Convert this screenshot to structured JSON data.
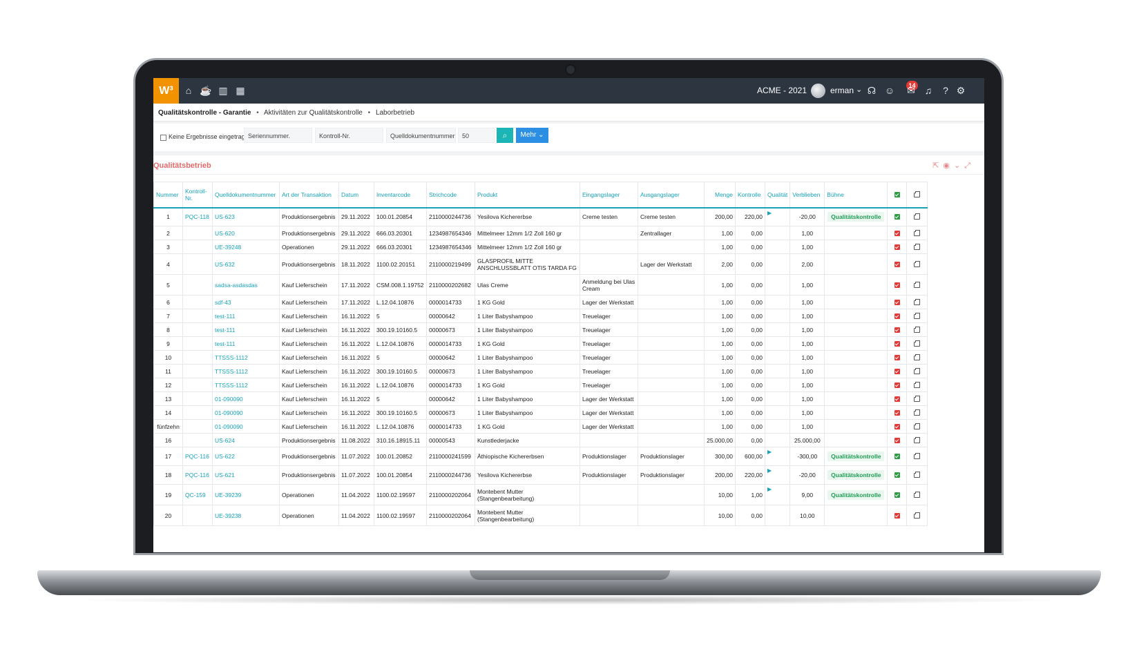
{
  "app": {
    "logo": "W³",
    "company": "ACME - 2021",
    "user": "erman",
    "notification_count": "14"
  },
  "icons": {
    "nav": [
      "home-icon",
      "cup-icon",
      "chart-icon",
      "calendar-icon"
    ],
    "right": [
      "headset-icon",
      "emoji-icon",
      "chat-icon",
      "bell-icon",
      "help-icon",
      "gear-icon"
    ]
  },
  "breadcrumb": {
    "current": "Qualitätskontrolle - Garantie",
    "items": [
      "Aktivitäten zur Qualitätskontrolle",
      "Laborbetrieb"
    ]
  },
  "filters": {
    "no_results_label": "Keine Ergebnisse eingetragen",
    "serial_placeholder": "Seriennummer.",
    "control_placeholder": "Kontroll-Nr.",
    "source_placeholder": "Quelldokumentnummer",
    "limit_value": "50",
    "more_label": "Mehr"
  },
  "panel": {
    "title": "Qualitätsbetrieb"
  },
  "table": {
    "headers": {
      "num": "Nummer",
      "ctrl": "Kontroll-Nr.",
      "src": "Quelldokumentnummer",
      "type": "Art der Transaktion",
      "date": "Datum",
      "inv": "Inventarcode",
      "bar": "Strichcode",
      "prod": "Produkt",
      "in": "Eingangslager",
      "out": "Ausgangslager",
      "qty": "Menge",
      "chk": "Kontrolle",
      "qual": "Qualität",
      "rem": "Verblieben",
      "stage": "Bühne"
    },
    "rows": [
      [
        "1",
        "PQC-118",
        "US-623",
        "Produktionsergebnis",
        "29.11.2022",
        "100.01.20854",
        "2110000244736",
        "Yesilova Kichererbse",
        "Creme testen",
        "Creme testen",
        "200,00",
        "220,00",
        true,
        "-20,00",
        "Qualitätskontrolle",
        "green"
      ],
      [
        "2",
        "",
        "US-620",
        "Produktionsergebnis",
        "29.11.2022",
        "666.03.20301",
        "1234987654346",
        "Mittelmeer 12mm 1/2 Zoll 160 gr",
        "",
        "Zentrallager",
        "1,00",
        "0,00",
        false,
        "1,00",
        "",
        "red"
      ],
      [
        "3",
        "",
        "UE-39248",
        "Operationen",
        "29.11.2022",
        "666.03.20301",
        "1234987654346",
        "Mittelmeer 12mm 1/2 Zoll 160 gr",
        "",
        "",
        "1,00",
        "0,00",
        false,
        "1,00",
        "",
        "red"
      ],
      [
        "4",
        "",
        "US-632",
        "Produktionsergebnis",
        "18.11.2022",
        "1100.02.20151",
        "2110000219499",
        "GLASPROFIL MITTE ANSCHLUSSBLATT OTIS TARDA FG",
        "",
        "Lager der Werkstatt",
        "2,00",
        "0,00",
        false,
        "2,00",
        "",
        "red"
      ],
      [
        "5",
        "",
        "sadsa-asdasdas",
        "Kauf Lieferschein",
        "17.11.2022",
        "CSM.008.1.19752",
        "2110000202682",
        "Ulas Creme",
        "Anmeldung bei Ulas Cream",
        "",
        "1,00",
        "0,00",
        false,
        "1,00",
        "",
        "red"
      ],
      [
        "6",
        "",
        "sdf-43",
        "Kauf Lieferschein",
        "17.11.2022",
        "L.12.04.10876",
        "0000014733",
        "1 KG Gold",
        "Lager der Werkstatt",
        "",
        "1,00",
        "0,00",
        false,
        "1,00",
        "",
        "red"
      ],
      [
        "7",
        "",
        "test-111",
        "Kauf Lieferschein",
        "16.11.2022",
        "5",
        "00000642",
        "1 Liter Babyshampoo",
        "Treuelager",
        "",
        "1,00",
        "0,00",
        false,
        "1,00",
        "",
        "red"
      ],
      [
        "8",
        "",
        "test-111",
        "Kauf Lieferschein",
        "16.11.2022",
        "300.19.10160.5",
        "00000673",
        "1 Liter Babyshampoo",
        "Treuelager",
        "",
        "1,00",
        "0,00",
        false,
        "1,00",
        "",
        "red"
      ],
      [
        "9",
        "",
        "test-111",
        "Kauf Lieferschein",
        "16.11.2022",
        "L.12.04.10876",
        "0000014733",
        "1 KG Gold",
        "Treuelager",
        "",
        "1,00",
        "0,00",
        false,
        "1,00",
        "",
        "red"
      ],
      [
        "10",
        "",
        "TTSSS-1112",
        "Kauf Lieferschein",
        "16.11.2022",
        "5",
        "00000642",
        "1 Liter Babyshampoo",
        "Treuelager",
        "",
        "1,00",
        "0,00",
        false,
        "1,00",
        "",
        "red"
      ],
      [
        "11",
        "",
        "TTSSS-1112",
        "Kauf Lieferschein",
        "16.11.2022",
        "300.19.10160.5",
        "00000673",
        "1 Liter Babyshampoo",
        "Treuelager",
        "",
        "1,00",
        "0,00",
        false,
        "1,00",
        "",
        "red"
      ],
      [
        "12",
        "",
        "TTSSS-1112",
        "Kauf Lieferschein",
        "16.11.2022",
        "L.12.04.10876",
        "0000014733",
        "1 KG Gold",
        "Treuelager",
        "",
        "1,00",
        "0,00",
        false,
        "1,00",
        "",
        "red"
      ],
      [
        "13",
        "",
        "01-090090",
        "Kauf Lieferschein",
        "16.11.2022",
        "5",
        "00000642",
        "1 Liter Babyshampoo",
        "Lager der Werkstatt",
        "",
        "1,00",
        "0,00",
        false,
        "1,00",
        "",
        "red"
      ],
      [
        "14",
        "",
        "01-090090",
        "Kauf Lieferschein",
        "16.11.2022",
        "300.19.10160.5",
        "00000673",
        "1 Liter Babyshampoo",
        "Lager der Werkstatt",
        "",
        "1,00",
        "0,00",
        false,
        "1,00",
        "",
        "red"
      ],
      [
        "fünfzehn",
        "",
        "01-090090",
        "Kauf Lieferschein",
        "16.11.2022",
        "L.12.04.10876",
        "0000014733",
        "1 KG Gold",
        "Lager der Werkstatt",
        "",
        "1,00",
        "0,00",
        false,
        "1,00",
        "",
        "red"
      ],
      [
        "16",
        "",
        "US-624",
        "Produktionsergebnis",
        "11.08.2022",
        "310.16.18915.11",
        "00000543",
        "Kunstlederjacke",
        "",
        "",
        "25.000,00",
        "0,00",
        false,
        "25.000,00",
        "",
        "red"
      ],
      [
        "17",
        "PQC-116",
        "US-622",
        "Produktionsergebnis",
        "11.07.2022",
        "100.01.20852",
        "2110000241599",
        "Äthiopische Kichererbsen",
        "Produktionslager",
        "Produktionslager",
        "300,00",
        "600,00",
        true,
        "-300,00",
        "Qualitätskontrolle",
        "green"
      ],
      [
        "18",
        "PQC-116",
        "US-621",
        "Produktionsergebnis",
        "11.07.2022",
        "100.01.20854",
        "2110000244736",
        "Yesilova Kichererbse",
        "Produktionslager",
        "Produktionslager",
        "200,00",
        "220,00",
        true,
        "-20,00",
        "Qualitätskontrolle",
        "green"
      ],
      [
        "19",
        "QC-159",
        "UE-39239",
        "Operationen",
        "11.04.2022",
        "1100.02.19597",
        "2110000202064",
        "Montebent Mutter (Stangenbearbeitung)",
        "",
        "",
        "10,00",
        "1,00",
        true,
        "9,00",
        "Qualitätskontrolle",
        "green"
      ],
      [
        "20",
        "",
        "UE-39238",
        "Operationen",
        "11.04.2022",
        "1100.02.19597",
        "2110000202064",
        "Montebent Mutter (Stangenbearbeitung)",
        "",
        "",
        "10,00",
        "0,00",
        false,
        "10,00",
        "",
        "red"
      ]
    ]
  }
}
